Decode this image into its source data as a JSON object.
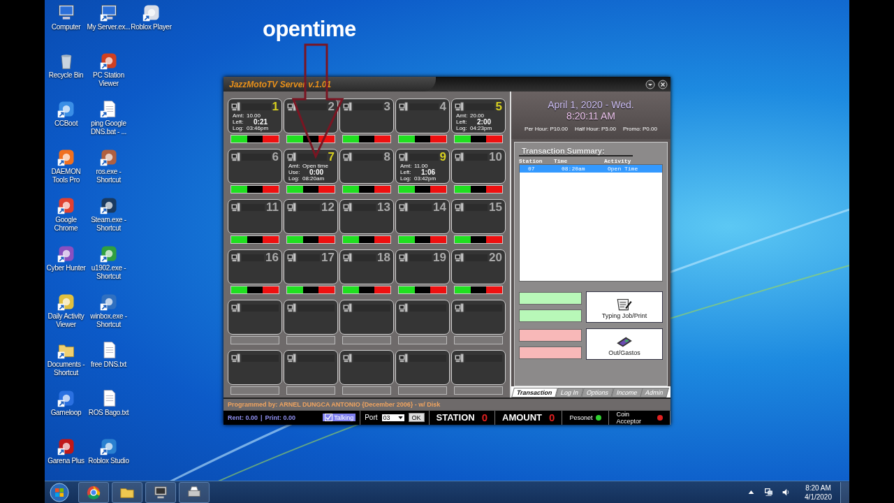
{
  "desktop": {
    "icon_columns": [
      {
        "icons": [
          {
            "label": "Computer",
            "kind": "computer",
            "shortcut": false
          },
          {
            "label": "Recycle Bin",
            "kind": "bin",
            "shortcut": false
          },
          {
            "label": "CCBoot",
            "kind": "app",
            "color": "#3a8ee6",
            "shortcut": true
          },
          {
            "label": "DAEMON Tools Pro",
            "kind": "app",
            "color": "#f07020",
            "shortcut": true
          },
          {
            "label": "Google Chrome",
            "kind": "app",
            "color": "#e04030",
            "shortcut": true
          },
          {
            "label": "Cyber Hunter",
            "kind": "app",
            "color": "#8a50c0",
            "shortcut": true
          },
          {
            "label": "Daily Activity Viewer",
            "kind": "app",
            "color": "#e0c040",
            "shortcut": true
          },
          {
            "label": "Documents - Shortcut",
            "kind": "folder",
            "shortcut": true
          },
          {
            "label": "Gameloop",
            "kind": "app",
            "color": "#2a70e0",
            "shortcut": true
          },
          {
            "label": "Garena Plus",
            "kind": "app",
            "color": "#c01818",
            "shortcut": true
          }
        ]
      },
      {
        "icons": [
          {
            "label": "My Server.ex...",
            "kind": "computer",
            "shortcut": true
          },
          {
            "label": "PC Station Viewer",
            "kind": "app",
            "color": "#d04020",
            "shortcut": true
          },
          {
            "label": "ping Google DNS.bat - ...",
            "kind": "file",
            "shortcut": true
          },
          {
            "label": "ros.exe - Shortcut",
            "kind": "app",
            "color": "#b06040",
            "shortcut": true
          },
          {
            "label": "Steam.exe - Shortcut",
            "kind": "app",
            "color": "#1a3a60",
            "shortcut": true
          },
          {
            "label": "u1902.exe - Shortcut",
            "kind": "app",
            "color": "#30a040",
            "shortcut": true
          },
          {
            "label": "winbox.exe - Shortcut",
            "kind": "app",
            "color": "#3070c0",
            "shortcut": true
          },
          {
            "label": "free DNS.txt",
            "kind": "file",
            "shortcut": false
          },
          {
            "label": "ROS Bago.txt",
            "kind": "file",
            "shortcut": false
          },
          {
            "label": "Roblox Studio",
            "kind": "app",
            "color": "#2a80d0",
            "shortcut": true
          }
        ]
      },
      {
        "icons": [
          {
            "label": "Roblox Player",
            "kind": "app",
            "color": "#d8dde8",
            "shortcut": true
          }
        ]
      }
    ]
  },
  "annotation": {
    "text": "opentime"
  },
  "window": {
    "title": "JazzMotoTV Server v.1.01",
    "stations": [
      {
        "kind": "station",
        "number": "1",
        "active": true,
        "details": [
          {
            "label": "Amt:",
            "value": "10.00"
          },
          {
            "label": "Left:",
            "value": "0:21"
          },
          {
            "label": "Log:",
            "value": "03:46pm"
          }
        ]
      },
      {
        "kind": "station",
        "number": "2",
        "active": false
      },
      {
        "kind": "station",
        "number": "3",
        "active": false
      },
      {
        "kind": "station",
        "number": "4",
        "active": false
      },
      {
        "kind": "station",
        "number": "5",
        "active": true,
        "details": [
          {
            "label": "Amt:",
            "value": "20.00"
          },
          {
            "label": "Left:",
            "value": "2:00"
          },
          {
            "label": "Log:",
            "value": "04:23pm"
          }
        ]
      },
      {
        "kind": "station",
        "number": "6",
        "active": false
      },
      {
        "kind": "station",
        "number": "7",
        "active": true,
        "details": [
          {
            "label": "Amt:",
            "value": "Open time"
          },
          {
            "label": "Use:",
            "value": "0:00"
          },
          {
            "label": "Log:",
            "value": "08:20am"
          }
        ]
      },
      {
        "kind": "station",
        "number": "8",
        "active": false
      },
      {
        "kind": "station",
        "number": "9",
        "active": true,
        "details": [
          {
            "label": "Amt:",
            "value": "11.00"
          },
          {
            "label": "Left:",
            "value": "1:06"
          },
          {
            "label": "Log:",
            "value": "03:42pm"
          }
        ]
      },
      {
        "kind": "station",
        "number": "10",
        "active": false
      },
      {
        "kind": "station",
        "number": "11",
        "active": false
      },
      {
        "kind": "station",
        "number": "12",
        "active": false
      },
      {
        "kind": "station",
        "number": "13",
        "active": false
      },
      {
        "kind": "station",
        "number": "14",
        "active": false
      },
      {
        "kind": "station",
        "number": "15",
        "active": false
      },
      {
        "kind": "station",
        "number": "16",
        "active": false
      },
      {
        "kind": "station",
        "number": "17",
        "active": false
      },
      {
        "kind": "station",
        "number": "18",
        "active": false
      },
      {
        "kind": "station",
        "number": "19",
        "active": false
      },
      {
        "kind": "station",
        "number": "20",
        "active": false
      },
      {
        "kind": "blank"
      },
      {
        "kind": "blank"
      },
      {
        "kind": "blank"
      },
      {
        "kind": "blank"
      },
      {
        "kind": "blank"
      },
      {
        "kind": "blank"
      },
      {
        "kind": "blank"
      },
      {
        "kind": "blank"
      },
      {
        "kind": "blank"
      },
      {
        "kind": "blank"
      }
    ],
    "date": "April 1, 2020 - Wed.",
    "time": "8:20:11 AM",
    "rates": [
      "Per Hour: P10.00",
      "Half Hour: P5.00",
      "Promo: P0.00"
    ],
    "summary": {
      "title": "Transaction Summary:",
      "columns": [
        "Station",
        "Time",
        "Activity"
      ],
      "rows": [
        {
          "cells": [
            "07",
            "08:20am",
            "Open Time"
          ],
          "selected": true
        }
      ]
    },
    "entry_groups": [
      {
        "fields": [
          {
            "color": "#b8f8b8"
          },
          {
            "color": "#b8f8b8"
          }
        ],
        "button": {
          "label": "Typing Job/Print",
          "kind": "print"
        }
      },
      {
        "fields": [
          {
            "color": "#f8b8b8"
          },
          {
            "color": "#f8b8b8"
          }
        ],
        "button": {
          "label": "Out/Gastos",
          "kind": "calculator"
        }
      }
    ],
    "tabs": [
      {
        "label": "Transaction",
        "selected": true
      },
      {
        "label": "Log In",
        "selected": false
      },
      {
        "label": "Options",
        "selected": false
      },
      {
        "label": "Income",
        "selected": false
      },
      {
        "label": "Admin",
        "selected": false
      }
    ],
    "credit": "Programmed by: ARNEL DUNGCA ANTONIO {December 2006} - w/ Disk",
    "status": {
      "rent": "Rent: 0.00",
      "separator": "|",
      "print": "Print: 0.00",
      "talking": {
        "label": "Talking",
        "checked": true
      },
      "port_label": "Port",
      "port": "03",
      "ok": "OK",
      "station_label": "STATION",
      "station": "0",
      "amount_label": "AMOUNT",
      "amount": "0",
      "lamps": [
        {
          "label": "Pesonet",
          "color": "#30d030"
        },
        {
          "label": "Coin Acceptor",
          "color": "#e02020"
        }
      ]
    }
  },
  "taskbar": {
    "apps": [
      {
        "kind": "chrome"
      },
      {
        "kind": "folder"
      },
      {
        "kind": "computer"
      },
      {
        "kind": "printer"
      }
    ],
    "time": "8:20 AM",
    "date": "4/1/2020"
  }
}
